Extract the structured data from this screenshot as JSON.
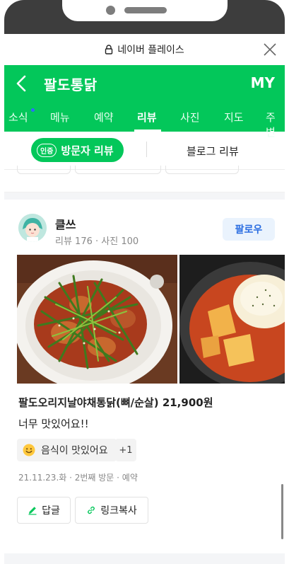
{
  "browser": {
    "title": "네이버 플레이스"
  },
  "header": {
    "store_name": "팔도통닭",
    "my_label": "MY"
  },
  "tabs": [
    {
      "label": "소식",
      "has_new": true
    },
    {
      "label": "메뉴"
    },
    {
      "label": "예약"
    },
    {
      "label": "리뷰",
      "active": true
    },
    {
      "label": "사진"
    },
    {
      "label": "지도"
    },
    {
      "label": "주변"
    }
  ],
  "review_filter": {
    "verified_badge": "인증",
    "visitor_label": "방문자 리뷰",
    "blog_label": "블로그 리뷰"
  },
  "review": {
    "reviewer_name": "클쓰",
    "reviewer_stats": "리뷰 176 · 사진 100",
    "follow_label": "팔로우",
    "menu_line": "팔도오리지날야채통닭(뼈/순살) 21,900원",
    "text": "너무 맛있어요!!",
    "keyword": "음식이 맛있어요",
    "keyword_extra": "+1",
    "visit_meta": "21.11.23.화 · 2번째 방문 · 예약",
    "reply_label": "답글",
    "copy_link_label": "링크복사"
  },
  "colors": {
    "brand_green": "#03c75a",
    "follow_blue": "#2a6de1",
    "new_dot": "#2d6cff"
  },
  "icons": {
    "lock": "lock-icon",
    "close": "close-icon",
    "back": "back-icon",
    "smile": "smile-icon",
    "pencil": "pencil-icon",
    "link": "link-icon"
  }
}
